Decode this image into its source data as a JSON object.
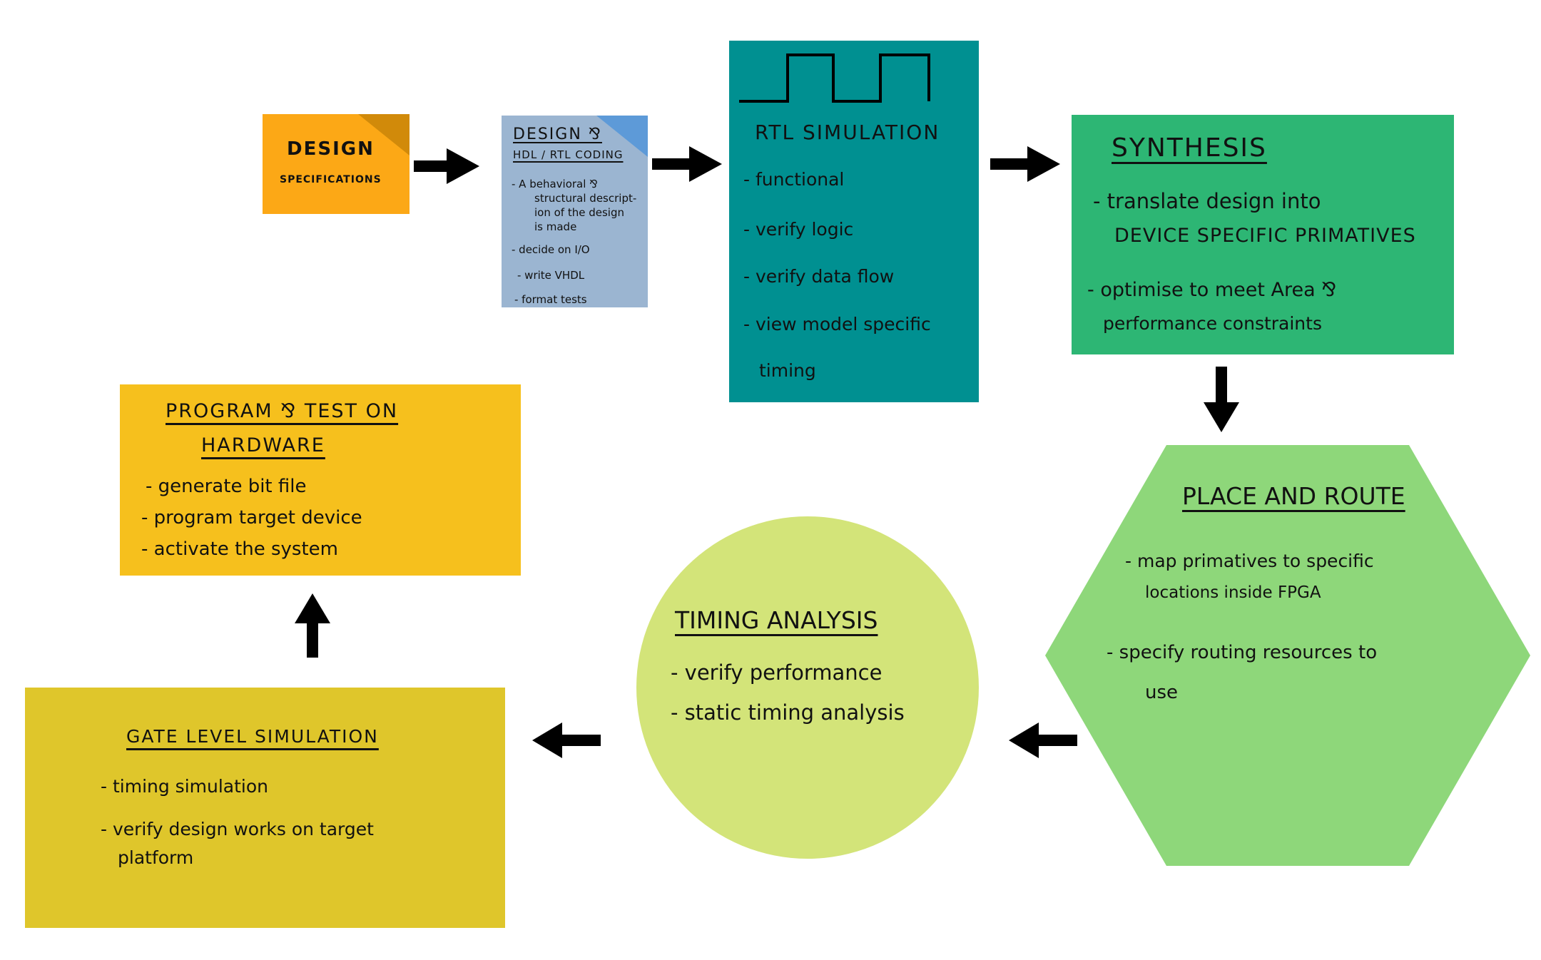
{
  "colors": {
    "design_specs": "#fca816",
    "design_specs_fold": "#d18a0a",
    "hdl_coding": "#9bb5d1",
    "hdl_coding_fold": "#5d9ad8",
    "rtl_sim": "#009091",
    "synthesis": "#2db674",
    "place_route": "#8ed77a",
    "timing": "#d3e479",
    "gate_sim": "#dfc62b",
    "program_test": "#f6c01d",
    "arrow": "#000000"
  },
  "design_specs": {
    "title": "DESIGN",
    "subtitle": "SPECIFICATIONS"
  },
  "hdl_coding": {
    "title": "DESIGN ⅋",
    "subtitle": "HDL / RTL CODING",
    "items": [
      "- A behavioral ⅋",
      "structural descript-",
      "ion of the design",
      "is made",
      "- decide on  I/O",
      "- write  VHDL",
      "- format  tests"
    ]
  },
  "rtl_sim": {
    "title": "RTL  SIMULATION",
    "items": [
      "- functional",
      "- verify  logic",
      "- verify  data  flow",
      "- view  model  specific",
      "timing"
    ]
  },
  "synthesis": {
    "title": "SYNTHESIS",
    "items": [
      "- translate  design  into",
      "DEVICE  SPECIFIC  PRIMATIVES",
      "- optimise  to  meet   Area  ⅋",
      "performance  constraints"
    ]
  },
  "place_route": {
    "title": "PLACE AND ROUTE",
    "items": [
      "- map  primatives  to  specific",
      "locations  inside  FPGA",
      "-   specify  routing   resources  to",
      "use"
    ]
  },
  "timing": {
    "title": "TIMING ANALYSIS",
    "items": [
      "- verify  performance",
      "- static  timing  analysis"
    ]
  },
  "gate_sim": {
    "title": "GATE  LEVEL  SIMULATION",
    "items": [
      "- timing  simulation",
      "- verify   design    works   on   target",
      "platform"
    ]
  },
  "program_test": {
    "title_line1": "PROGRAM ⅋ TEST ON",
    "title_line2": "HARDWARE",
    "items": [
      "- generate  bit  file",
      "- program  target  device",
      "- activate  the  system"
    ]
  }
}
